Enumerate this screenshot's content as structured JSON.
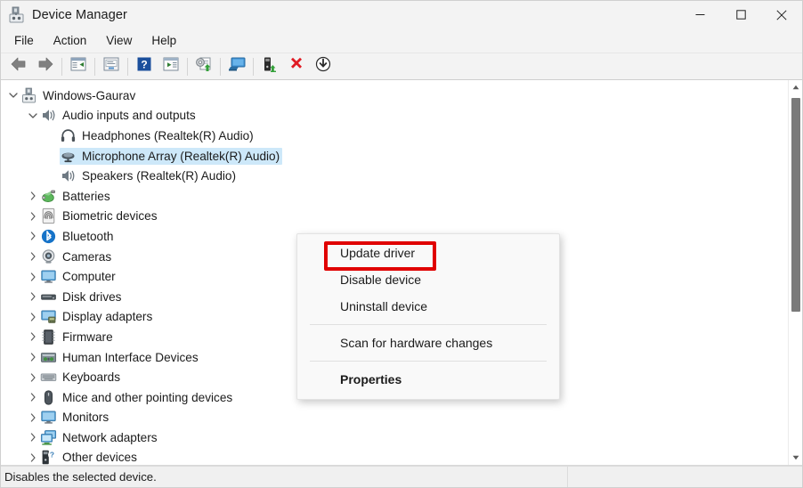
{
  "window": {
    "title": "Device Manager",
    "icon": "device-manager-icon",
    "controls": [
      {
        "name": "minimize-button",
        "glyph": "minimize"
      },
      {
        "name": "maximize-button",
        "glyph": "maximize"
      },
      {
        "name": "close-button",
        "glyph": "close"
      }
    ]
  },
  "menubar": {
    "items": [
      {
        "label": "File"
      },
      {
        "label": "Action"
      },
      {
        "label": "View"
      },
      {
        "label": "Help"
      }
    ]
  },
  "toolbar": {
    "buttons": [
      {
        "name": "back-button",
        "icon": "back-arrow-icon"
      },
      {
        "name": "forward-button",
        "icon": "forward-arrow-icon"
      },
      {
        "name": "up-one-level-button",
        "icon": "up-level-icon"
      },
      {
        "name": "show-hide-console-tree-button",
        "icon": "console-tree-icon"
      },
      {
        "name": "help-button",
        "icon": "help-icon"
      },
      {
        "name": "properties-button",
        "icon": "properties-icon"
      },
      {
        "name": "update-driver-button",
        "icon": "update-driver-icon"
      },
      {
        "name": "scan-hardware-changes-button",
        "icon": "scan-hardware-icon"
      },
      {
        "name": "enable-device-button",
        "icon": "enable-device-icon"
      },
      {
        "name": "uninstall-device-button",
        "icon": "uninstall-device-icon"
      },
      {
        "name": "disable-device-button",
        "icon": "disable-device-icon"
      }
    ]
  },
  "tree": {
    "nodes": [
      {
        "label": "Windows-Gaurav",
        "level": 0,
        "expander": "expanded",
        "icon": "computer-icon",
        "selected": false
      },
      {
        "label": "Audio inputs and outputs",
        "level": 1,
        "expander": "expanded",
        "icon": "speaker-icon",
        "selected": false
      },
      {
        "label": "Headphones (Realtek(R) Audio)",
        "level": 2,
        "expander": "none",
        "icon": "headphones-icon",
        "selected": false
      },
      {
        "label": "Microphone Array (Realtek(R) Audio)",
        "level": 2,
        "expander": "none",
        "icon": "microphone-icon",
        "selected": true
      },
      {
        "label": "Speakers (Realtek(R) Audio)",
        "level": 2,
        "expander": "none",
        "icon": "speaker-icon",
        "selected": false
      },
      {
        "label": "Batteries",
        "level": 1,
        "expander": "collapsed",
        "icon": "battery-icon",
        "selected": false
      },
      {
        "label": "Biometric devices",
        "level": 1,
        "expander": "collapsed",
        "icon": "fingerprint-icon",
        "selected": false
      },
      {
        "label": "Bluetooth",
        "level": 1,
        "expander": "collapsed",
        "icon": "bluetooth-icon",
        "selected": false
      },
      {
        "label": "Cameras",
        "level": 1,
        "expander": "collapsed",
        "icon": "camera-icon",
        "selected": false
      },
      {
        "label": "Computer",
        "level": 1,
        "expander": "collapsed",
        "icon": "monitor-icon",
        "selected": false
      },
      {
        "label": "Disk drives",
        "level": 1,
        "expander": "collapsed",
        "icon": "disk-drive-icon",
        "selected": false
      },
      {
        "label": "Display adapters",
        "level": 1,
        "expander": "collapsed",
        "icon": "display-adapter-icon",
        "selected": false
      },
      {
        "label": "Firmware",
        "level": 1,
        "expander": "collapsed",
        "icon": "firmware-chip-icon",
        "selected": false
      },
      {
        "label": "Human Interface Devices",
        "level": 1,
        "expander": "collapsed",
        "icon": "hid-icon",
        "selected": false
      },
      {
        "label": "Keyboards",
        "level": 1,
        "expander": "collapsed",
        "icon": "keyboard-icon",
        "selected": false
      },
      {
        "label": "Mice and other pointing devices",
        "level": 1,
        "expander": "collapsed",
        "icon": "mouse-icon",
        "selected": false
      },
      {
        "label": "Monitors",
        "level": 1,
        "expander": "collapsed",
        "icon": "monitor-icon",
        "selected": false
      },
      {
        "label": "Network adapters",
        "level": 1,
        "expander": "collapsed",
        "icon": "network-adapter-icon",
        "selected": false
      },
      {
        "label": "Other devices",
        "level": 1,
        "expander": "collapsed",
        "icon": "unknown-device-icon",
        "selected": false
      }
    ]
  },
  "context_menu": {
    "items": [
      {
        "label": "Update driver",
        "bold": false,
        "highlighted": true,
        "separator_after": false
      },
      {
        "label": "Disable device",
        "bold": false,
        "highlighted": false,
        "separator_after": false
      },
      {
        "label": "Uninstall device",
        "bold": false,
        "highlighted": false,
        "separator_after": true
      },
      {
        "label": "Scan for hardware changes",
        "bold": false,
        "highlighted": false,
        "separator_after": true
      },
      {
        "label": "Properties",
        "bold": true,
        "highlighted": false,
        "separator_after": false
      }
    ]
  },
  "statusbar": {
    "text": "Disables the selected device.",
    "right_text": ""
  },
  "colors": {
    "window_bg": "#f3f3f3",
    "content_bg": "#ffffff",
    "selection": "#cde8f9",
    "highlight_box": "#e00000",
    "text": "#1b1b1b",
    "menu_bg": "#f9f9f9",
    "scrollbar_thumb": "#7a7a7a"
  }
}
